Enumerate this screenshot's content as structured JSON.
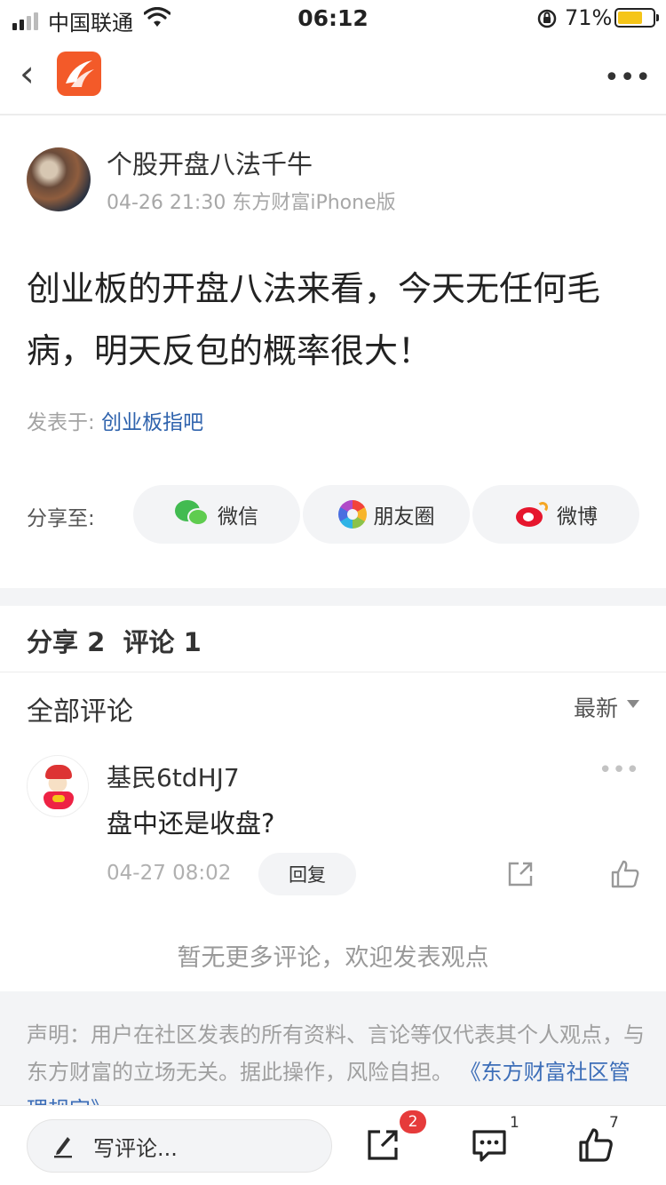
{
  "status_bar": {
    "carrier": "中国联通",
    "time": "06:12",
    "battery": "71%",
    "battery_level": 0.71
  },
  "nav": {
    "back_icon": "chevron-left-icon",
    "logo_icon": "eastmoney-app-logo",
    "more_icon": "more-dots-icon"
  },
  "post": {
    "author": "个股开盘八法千牛",
    "time": "04-26 21:30",
    "source": "东方财富iPhone版",
    "content": "创业板的开盘八法来看，今天无任何毛病，明天反包的概率很大！",
    "forum_label": "发表于: ",
    "forum_name": "创业板指吧"
  },
  "share": {
    "label": "分享至:",
    "wechat": "微信",
    "moments": "朋友圈",
    "weibo": "微博"
  },
  "stats": {
    "share_label": "分享",
    "share_count": "2",
    "comment_label": "评论",
    "comment_count": "1"
  },
  "comments_header": {
    "title": "全部评论",
    "sort": "最新"
  },
  "comments": [
    {
      "user": "基民6tdHJ7",
      "text": "盘中还是收盘?",
      "time": "04-27 08:02",
      "reply_label": "回复"
    }
  ],
  "no_more": "暂无更多评论，欢迎发表观点",
  "declaration": {
    "text": "声明：用户在社区发表的所有资料、言论等仅代表其个人观点，与东方财富的立场无关。据此操作，风险自担。",
    "link": "《东方财富社区管理规定》"
  },
  "bottom_bar": {
    "placeholder": "写评论...",
    "share_badge": "2",
    "comment_badge": "1",
    "like_badge": "7"
  },
  "colors": {
    "brand": "#f35a29",
    "link": "#2f63ad",
    "badge": "#e63b3b",
    "battery": "#f5c518"
  }
}
